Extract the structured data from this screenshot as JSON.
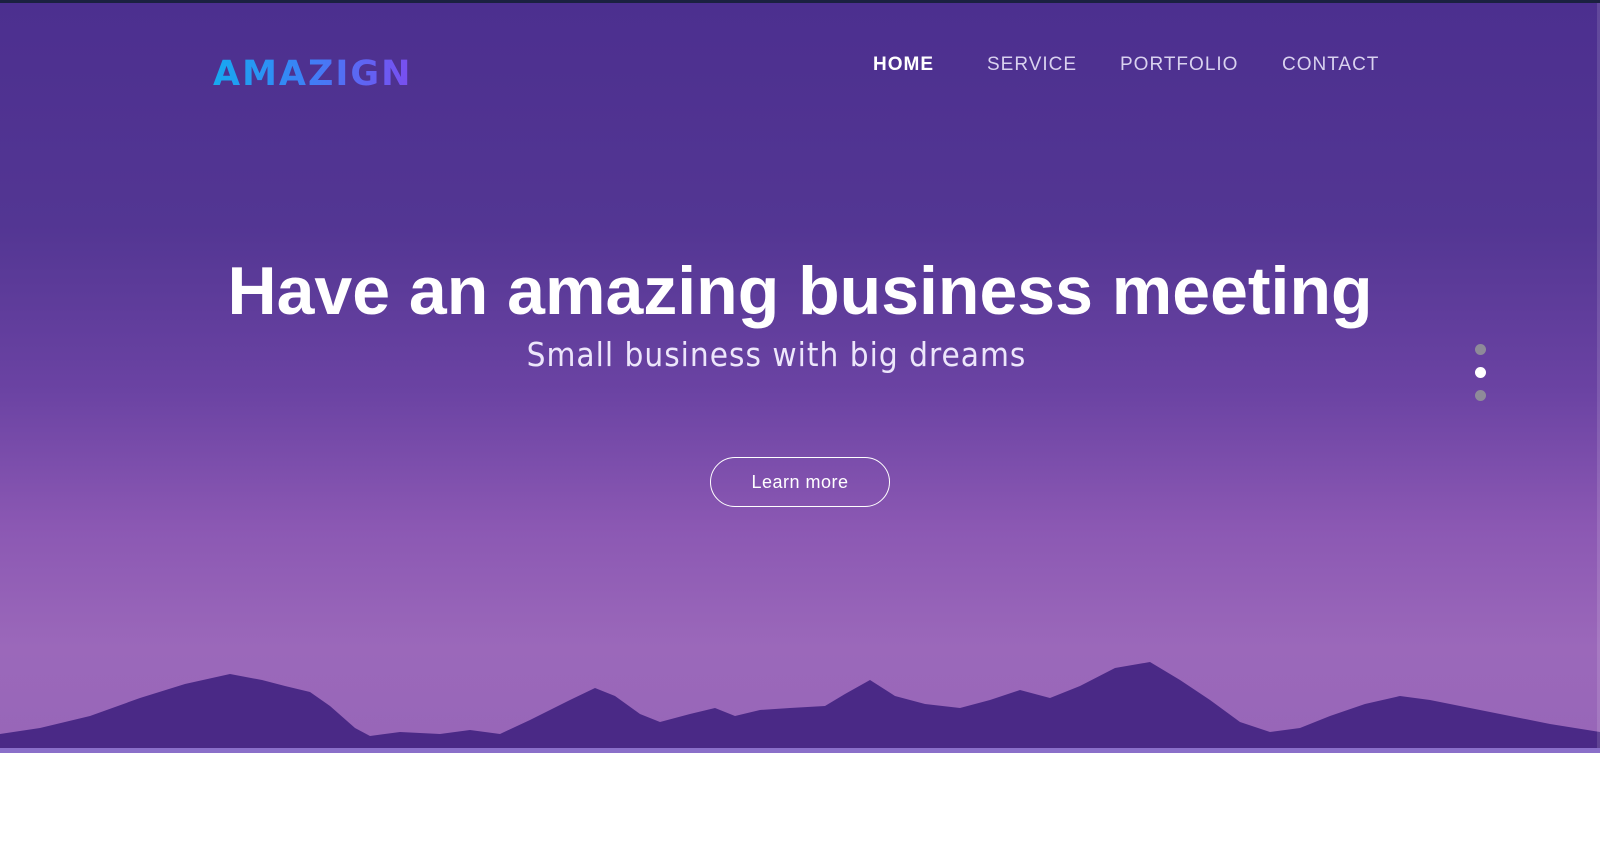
{
  "brand": {
    "logo_text": "AMAZIGN",
    "gradient": [
      "#16a9f0",
      "#7b4df0"
    ]
  },
  "nav": {
    "items": [
      {
        "label": "HOME",
        "active": true
      },
      {
        "label": "SERVICE",
        "active": false
      },
      {
        "label": "PORTFOLIO",
        "active": false
      },
      {
        "label": "CONTACT",
        "active": false
      }
    ]
  },
  "hero": {
    "title": "Have an amazing business meeting",
    "subtitle": "Small business with big dreams",
    "cta_label": "Learn more",
    "background_colors": [
      "#4c2f8f",
      "#9b68ba"
    ],
    "mountain_color": "#4a2986"
  },
  "slider": {
    "count": 3,
    "active_index": 1
  }
}
